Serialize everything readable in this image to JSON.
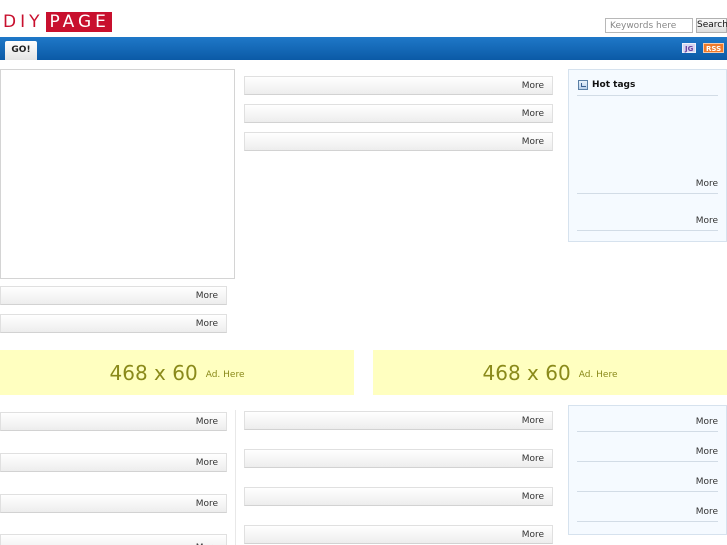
{
  "logo": {
    "part1": "DIY",
    "part2": "PAGE"
  },
  "search": {
    "placeholder": "Keywords here",
    "button_label": "Search"
  },
  "nav": {
    "tab_label": "GO!",
    "badge_jg": "JG",
    "badge_rss": "RSS"
  },
  "more_label": "More",
  "hot_tags": {
    "title": "Hot tags"
  },
  "ads": [
    {
      "size": "468 x 60",
      "label": "Ad. Here"
    },
    {
      "size": "468 x 60",
      "label": "Ad. Here"
    }
  ]
}
